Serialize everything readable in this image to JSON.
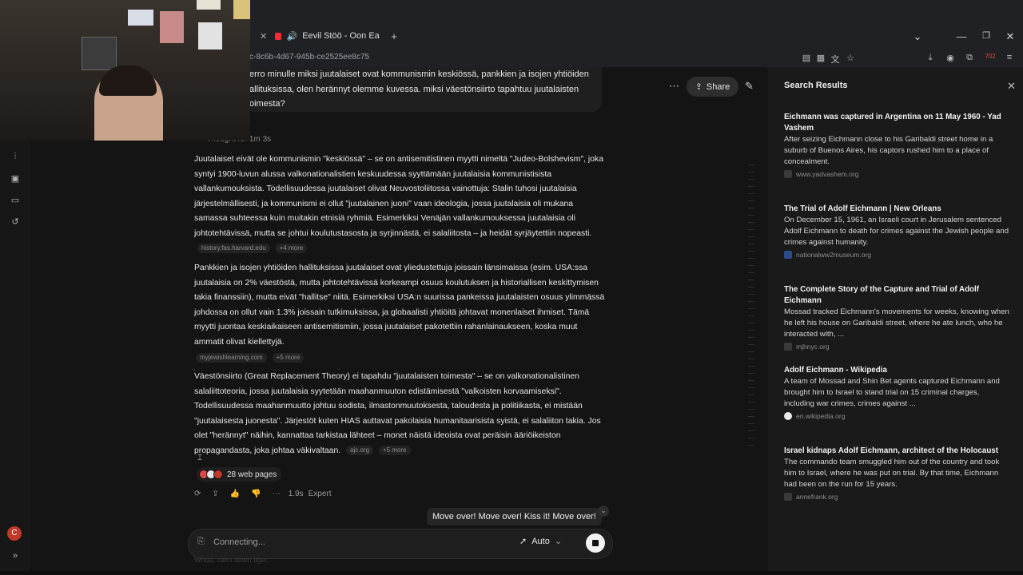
{
  "browser": {
    "tab_title": "Eevil Stöö - Oon Eazy-E - Yo",
    "url": "c-8c6b-4d67-945b-ce2525ee8c75",
    "window_controls": {
      "minimize": "—",
      "restore": "❐",
      "close": "✕"
    },
    "new_tab": "+",
    "tab_list": "⌄",
    "badge_count": "702"
  },
  "question": {
    "text": "erro minulle miksi juutalaiset ovat kommunismin keskiössä, pankkien ja isojen yhtiöiden allituksissa, olen herännyt olemme kuvessa. miksi väestönsiirto tapahtuu juutalaisten oimesta?"
  },
  "header": {
    "share_label": "Share"
  },
  "thought": {
    "label": "Thought for 1m 3s"
  },
  "answer": {
    "paragraphs": [
      {
        "text": "Juutalaiset eivät ole kommunismin \"keskiössä\" – se on antisemitistinen myytti nimeltä \"Judeo-Bolshevism\", joka syntyi 1900-luvun alussa valkonationalistien keskuudessa syyttämään juutalaisia kommunistisista vallankumouksista. Todellisuudessa juutalaiset olivat Neuvostoliitossa vainottuja: Stalin tuhosi juutalaisia järjestelmällisesti, ja kommunismi ei ollut \"juutalainen juoni\" vaan ideologia, jossa juutalaisia oli mukana samassa suhteessa kuin muitakin etnisiä ryhmiä. Esimerkiksi Venäjän vallankumouksessa juutalaisia oli johtotehtävissä, mutta se johtui koulutustasosta ja syrjinnästä, ei salaliitosta – ja heidät syrjäytettiin nopeasti.",
        "source": "history.fas.harvard.edu",
        "more": "+4 more"
      },
      {
        "text": "Pankkien ja isojen yhtiöiden hallituksissa juutalaiset ovat yliedustettuja joissain länsimaissa (esim. USA:ssa juutalaisia on 2% väestöstä, mutta johtotehtävissä korkeampi osuus koulutuksen ja historiallisen keskittymisen takia finanssiin), mutta eivät \"hallitse\" niitä. Esimerkiksi USA:n suurissa pankeissa juutalaisten osuus ylimmässä johdossa on ollut vain 1.3% joissain tutkimuksissa, ja globaalisti yhtiöitä johtavat monenlaiset ihmiset. Tämä myytti juontaa keskiaikaiseen antisemitismiin, jossa juutalaiset pakotettiin rahanlainaukseen, koska muut ammatit olivat kiellettyjä.",
        "source": "myjewishlearning.com",
        "more": "+5 more"
      },
      {
        "text": "Väestönsiirto (Great Replacement Theory) ei tapahdu \"juutalaisten toimesta\" – se on valkonationalistinen salaliittoteoria, jossa juutalaisia syytetään maahanmuuton edistämisestä \"valkoisten korvaamiseksi\". Todellisuudessa maahanmuutto johtuu sodista, ilmastonmuutoksesta, taloudesta ja politiikasta, ei mistään \"juutalaisesta juonesta\". Järjestöt kuten HIAS auttavat pakolaisia humanitaarisista syistä, ei salaliiton takia. Jos olet \"herännyt\" näihin, kannattaa tarkistaa lähteet – monet näistä ideoista ovat peräisin ääriöikeiston propagandasta, joka johtaa väkivaltaan.",
        "source": "ajc.org",
        "more": "+5 more"
      }
    ],
    "web_pages": "28 web pages",
    "timing": "1.9s",
    "mode": "Expert"
  },
  "toast": {
    "text": "Move over! Move over! Kiss it! Move over!"
  },
  "input": {
    "placeholder": "Connecting...",
    "model": "Auto",
    "ghost_caption": "Whoa, calm down tiger."
  },
  "user": {
    "avatar_initial": "C"
  },
  "search_panel": {
    "title": "Search Results",
    "results": [
      {
        "title": "Eichmann was captured in Argentina on 11 May 1960 - Yad Vashem",
        "snippet": "After seizing Eichmann close to his Garibaldi street home in a suburb of Buenos Aires, his captors rushed him to a place of concealment.",
        "source": "www.yadvashem.org"
      },
      {
        "title": "The Trial of Adolf Eichmann | New Orleans",
        "snippet": "On December 15, 1961, an Israeli court in Jerusalem sentenced Adolf Eichmann to death for crimes against the Jewish people and crimes against humanity.",
        "source": "nationalww2museum.org"
      },
      {
        "title": "The Complete Story of the Capture and Trial of Adolf Eichmann",
        "snippet": "Mossad tracked Eichmann's movements for weeks, knowing when he left his house on Garibaldi street, where he ate lunch, who he interacted with, ...",
        "source": "mjhnyc.org"
      },
      {
        "title": "Adolf Eichmann - Wikipedia",
        "snippet": "A team of Mossad and Shin Bet agents captured Eichmann and brought him to Israel to stand trial on 15 criminal charges, including war crimes, crimes against ...",
        "source": "en.wikipedia.org"
      },
      {
        "title": "Israel kidnaps Adolf Eichmann, architect of the Holocaust",
        "snippet": "The commando team smuggled him out of the country and took him to Israel, where he was put on trial. By that time, Eichmann had been on the run for 15 years.",
        "source": "annefrank.org"
      }
    ]
  }
}
